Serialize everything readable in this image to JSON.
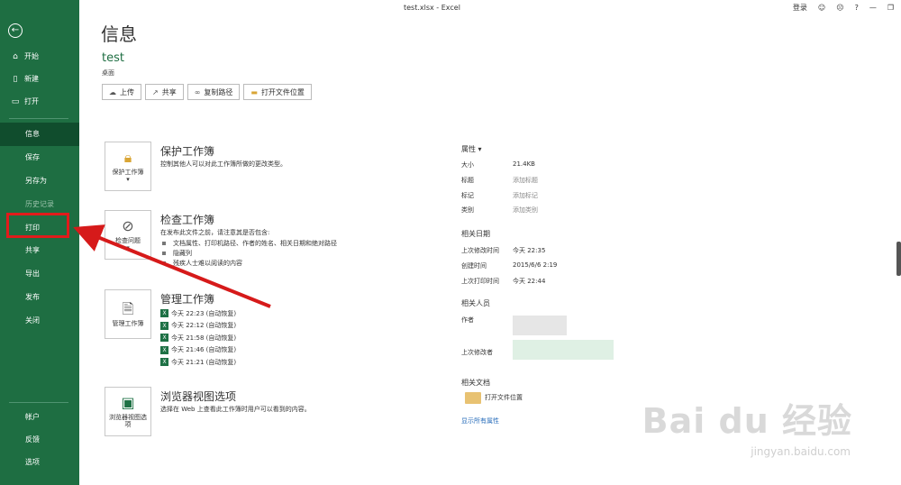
{
  "window": {
    "title": "test.xlsx - Excel",
    "login": "登录",
    "icons": [
      "smiley-icon",
      "frown-icon",
      "help-icon",
      "minimize-icon",
      "restore-icon"
    ]
  },
  "sidebar": {
    "top_items": [
      {
        "label": "开始",
        "icon": "home-icon"
      },
      {
        "label": "新建",
        "icon": "new-doc-icon"
      },
      {
        "label": "打开",
        "icon": "open-folder-icon"
      }
    ],
    "items": [
      {
        "label": "信息"
      },
      {
        "label": "保存"
      },
      {
        "label": "另存为"
      },
      {
        "label": "历史记录"
      },
      {
        "label": "打印"
      },
      {
        "label": "共享"
      },
      {
        "label": "导出"
      },
      {
        "label": "发布"
      },
      {
        "label": "关闭"
      }
    ],
    "bottom_items": [
      {
        "label": "帐户"
      },
      {
        "label": "反馈"
      },
      {
        "label": "选项"
      }
    ],
    "colors": {
      "bg": "#1e6e42",
      "active": "#104d2d",
      "highlight": "#e11b1b"
    }
  },
  "main": {
    "page_title": "信息",
    "file_name": "test",
    "file_location": "桌面",
    "buttons": [
      {
        "label": "上传",
        "icon": "upload-icon"
      },
      {
        "label": "共享",
        "icon": "share-icon"
      },
      {
        "label": "复制路径",
        "icon": "link-icon"
      },
      {
        "label": "打开文件位置",
        "icon": "folder-icon"
      }
    ],
    "protect": {
      "tile_label": "保护工作簿",
      "title": "保护工作簿",
      "desc": "控制其他人可以对此工作簿所做的更改类型。"
    },
    "inspect": {
      "tile_label": "检查问题",
      "title": "检查工作簿",
      "desc": "在发布此文件之前，请注意其是否包含:",
      "items": [
        "文档属性、打印机路径、作者的姓名、相关日期和绝对路径",
        "隐藏列",
        "残疾人士难以阅读的内容"
      ]
    },
    "manage": {
      "tile_label": "管理工作簿",
      "title": "管理工作簿",
      "versions": [
        "今天 22:23 (自动恢复)",
        "今天 22:12 (自动恢复)",
        "今天 21:58 (自动恢复)",
        "今天 21:46 (自动恢复)",
        "今天 21:21 (自动恢复)"
      ]
    },
    "browser": {
      "tile_label": "浏览器视图选项",
      "title": "浏览器视图选项",
      "desc": "选择在 Web 上查看此工作簿时用户可以看到的内容。"
    }
  },
  "properties": {
    "header": "属性",
    "rows": [
      {
        "key": "大小",
        "value": "21.4KB",
        "muted": false
      },
      {
        "key": "标题",
        "value": "添加标题",
        "muted": true
      },
      {
        "key": "标记",
        "value": "添加标记",
        "muted": true
      },
      {
        "key": "类别",
        "value": "添加类别",
        "muted": true
      }
    ],
    "dates_header": "相关日期",
    "dates": [
      {
        "key": "上次修改时间",
        "value": "今天 22:35"
      },
      {
        "key": "创建时间",
        "value": "2015/6/6 2:19"
      },
      {
        "key": "上次打印时间",
        "value": "今天 22:44"
      }
    ],
    "people_header": "相关人员",
    "author_label": "作者",
    "last_modified_by_label": "上次修改者",
    "docs_header": "相关文档",
    "open_location": "打开文件位置",
    "show_all": "显示所有属性"
  },
  "watermark": {
    "text": "Bai du 经验",
    "sub": "jingyan.baidu.com"
  }
}
